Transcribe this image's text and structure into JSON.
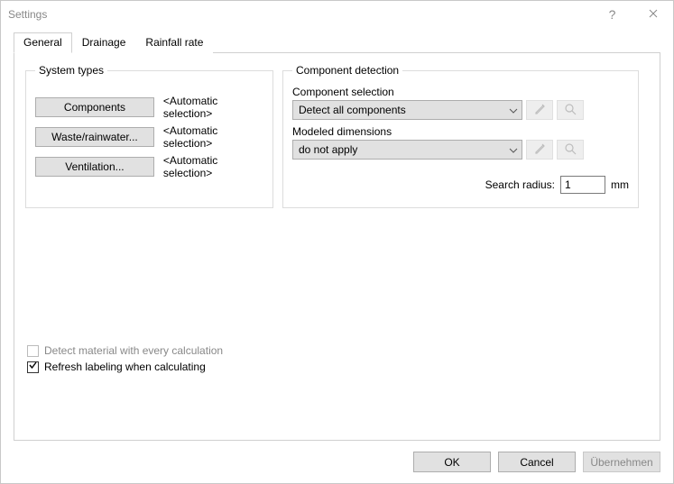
{
  "window": {
    "title": "Settings"
  },
  "tabs": {
    "general": "General",
    "drainage": "Drainage",
    "rainfall": "Rainfall rate"
  },
  "systemTypes": {
    "legend": "System types",
    "components": {
      "btn": "Components",
      "val": "<Automatic selection>"
    },
    "waste": {
      "btn": "Waste/rainwater...",
      "val": "<Automatic selection>"
    },
    "ventilation": {
      "btn": "Ventilation...",
      "val": "<Automatic selection>"
    }
  },
  "componentDetection": {
    "legend": "Component detection",
    "compSelLabel": "Component selection",
    "compSelValue": "Detect all components",
    "modelDimLabel": "Modeled dimensions",
    "modelDimValue": "do not apply",
    "searchRadiusLabel": "Search radius:",
    "searchRadiusValue": "1",
    "searchRadiusUnit": "mm"
  },
  "checks": {
    "detectMaterial": "Detect material with every calculation",
    "refreshLabeling": "Refresh labeling when calculating"
  },
  "buttons": {
    "ok": "OK",
    "cancel": "Cancel",
    "apply": "Übernehmen"
  }
}
